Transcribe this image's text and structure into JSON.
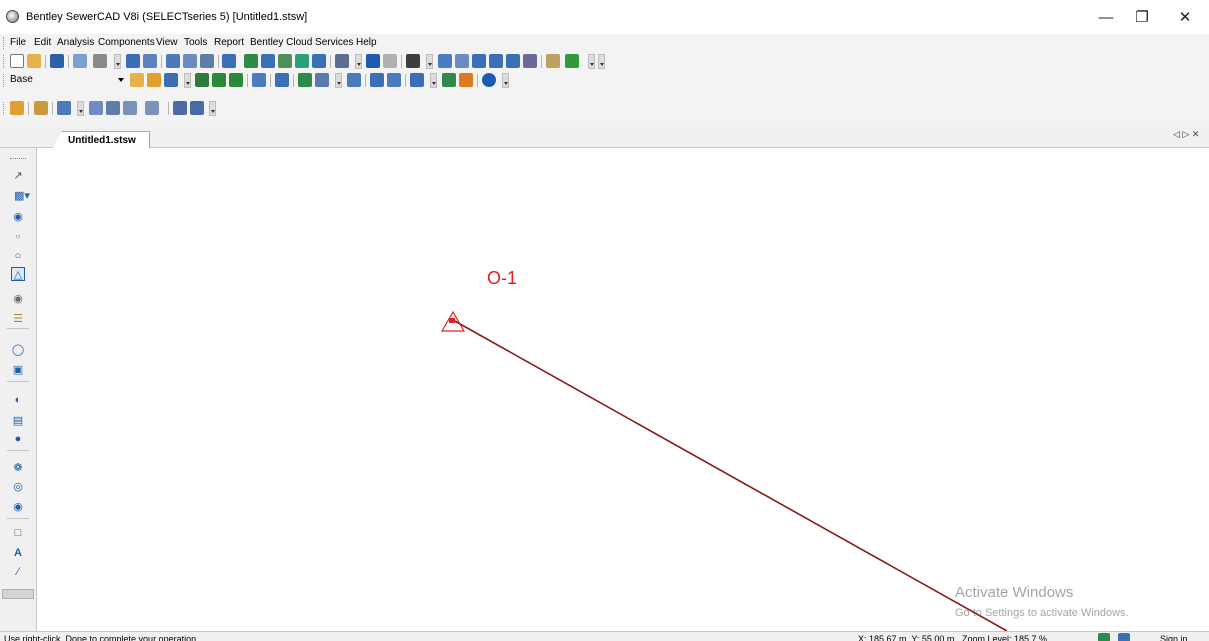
{
  "window": {
    "title": "Bentley SewerCAD V8i (SELECTseries 5) [Untitled1.stsw]",
    "minimize_glyph": "—",
    "restore_glyph": "❐",
    "close_glyph": "✕"
  },
  "menu": {
    "items": [
      {
        "label": "File"
      },
      {
        "label": "Edit"
      },
      {
        "label": "Analysis"
      },
      {
        "label": "Components"
      },
      {
        "label": "View"
      },
      {
        "label": "Tools"
      },
      {
        "label": "Report"
      },
      {
        "label": "Bentley Cloud Services"
      },
      {
        "label": "Help"
      }
    ]
  },
  "scenario_combo": {
    "value": "Base"
  },
  "document_tab": {
    "label": "Untitled1.stsw",
    "controls": "◁ ▷ ✕"
  },
  "drawing": {
    "node_label": "O-1",
    "node_color": "#e02020",
    "pipe_color": "#8b1a1a"
  },
  "watermark": {
    "line1": "Activate Windows",
    "line2": "Go to Settings to activate Windows."
  },
  "status": {
    "message": "Use right-click, Done to complete your operation.",
    "coordinates": "X: 185.67 m, Y: 55.00 m",
    "zoom": "Zoom Level: 185.7 %",
    "extra": "Sign in"
  },
  "palette_icons": [
    "select-arrow-icon",
    "layout-icon",
    "manhole-icon",
    "junction-icon",
    "catch-basin-icon",
    "outfall-icon",
    "wet-well-icon",
    "tank-icon",
    "pressure-junction-icon",
    "valve-icon",
    "pump-icon",
    "storage-icon",
    "air-valve-icon",
    "pump-station-icon",
    "property-connection-icon",
    "cleanout-icon",
    "border-icon",
    "text-icon",
    "line-icon"
  ]
}
